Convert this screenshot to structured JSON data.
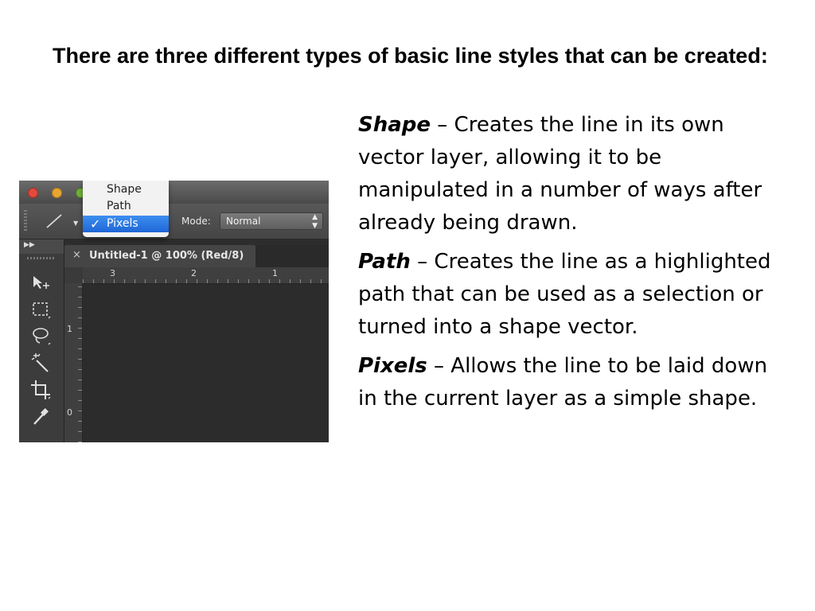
{
  "slide": {
    "heading": "There are three different types of basic line styles that can be created:",
    "definitions": [
      {
        "term": "Shape",
        "text": " – Creates the line in its own vector layer, allowing it to be manipulated in a number of ways after already being drawn."
      },
      {
        "term": "Path",
        "text": " – Creates the line as a highlighted path that can be used as a selection or turned into a shape vector."
      },
      {
        "term": "Pixels",
        "text": " – Allows the line to be laid down in the current layer as a simple shape."
      }
    ]
  },
  "screenshot": {
    "dropdown": {
      "options": [
        "Shape",
        "Path",
        "Pixels"
      ],
      "selected": "Pixels",
      "check": "✓"
    },
    "mode": {
      "label": "Mode:",
      "value": "Normal"
    },
    "document_tab": {
      "close": "×",
      "title": "Untitled-1 @ 100% (Red/8)"
    },
    "ruler": {
      "top_labels": [
        "3",
        "2",
        "1"
      ],
      "left_labels": [
        "1",
        "0"
      ]
    },
    "icons": {
      "line_tool": "line-tool-icon",
      "tools": [
        "move-tool-icon",
        "marquee-tool-icon",
        "lasso-tool-icon",
        "magic-wand-icon",
        "crop-tool-icon",
        "eyedropper-icon"
      ]
    },
    "colors": {
      "selected_option": "#1f66d6",
      "panel": "#3c3c3c",
      "canvas": "#2c2c2c"
    }
  }
}
